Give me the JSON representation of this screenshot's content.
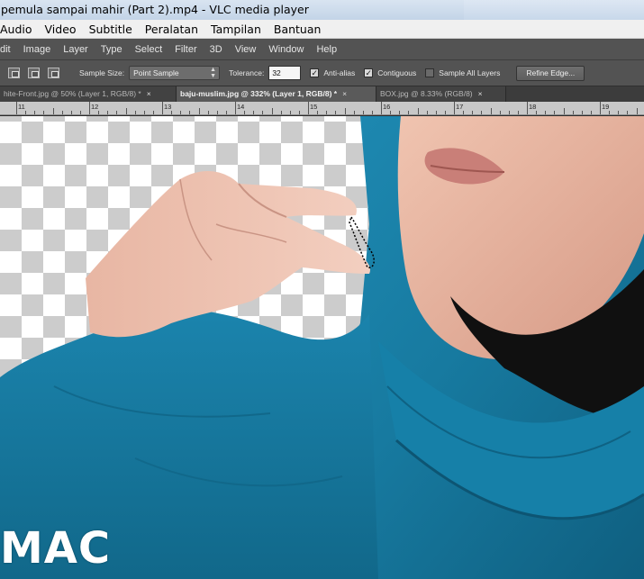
{
  "vlc": {
    "window_title": "pemula sampai mahir (Part 2).mp4 - VLC media player",
    "menu": [
      "Audio",
      "Video",
      "Subtitle",
      "Peralatan",
      "Tampilan",
      "Bantuan"
    ]
  },
  "photoshop": {
    "menu": [
      "dit",
      "Image",
      "Layer",
      "Type",
      "Select",
      "Filter",
      "3D",
      "View",
      "Window",
      "Help"
    ],
    "options": {
      "sample_size_label": "Sample Size:",
      "sample_size_value": "Point Sample",
      "tolerance_label": "Tolerance:",
      "tolerance_value": "32",
      "anti_alias_label": "Anti-alias",
      "anti_alias_checked": true,
      "contiguous_label": "Contiguous",
      "contiguous_checked": true,
      "sample_all_layers_label": "Sample All Layers",
      "sample_all_layers_checked": false,
      "refine_edge_label": "Refine Edge..."
    },
    "tabs": [
      {
        "label": "hite-Front.jpg @ 50% (Layer 1, RGB/8) *",
        "close": "×"
      },
      {
        "label": "baju-muslim.jpg @ 332% (Layer 1, RGB/8) *",
        "close": "×",
        "active": true
      },
      {
        "label": "BOX.jpg @ 8.33% (RGB/8)",
        "close": "×"
      }
    ],
    "ruler_labels": [
      "11",
      "12",
      "13",
      "14",
      "15",
      "16",
      "17",
      "18",
      "19"
    ]
  },
  "watermark": {
    "logo_text": "MAC"
  },
  "colors": {
    "hijab_teal": "#1a7fa3",
    "ps_panel": "#535353",
    "transparency_grey": "#cccccc"
  }
}
